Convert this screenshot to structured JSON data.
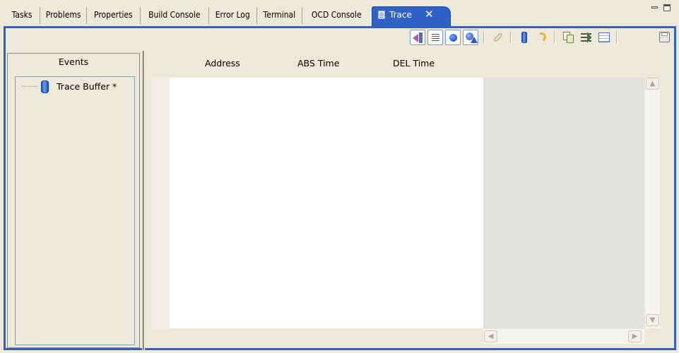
{
  "tabs": [
    "Tasks",
    "Problems",
    "Properties",
    "Build Console",
    "Error Log",
    "Terminal",
    "OCD Console"
  ],
  "active_tab": {
    "label": "Trace",
    "close": "✕"
  },
  "window_controls": {
    "minimize_icon": "minimize-icon",
    "maximize_icon": "maximize-icon"
  },
  "toolbar": {
    "icons": [
      "import-trace-icon",
      "list-view-icon",
      "record-icon",
      "trigger-setup-icon",
      "link-icon",
      "buffer-icon",
      "refresh-icon",
      "copy-icon",
      "filter-icon",
      "table-view-icon",
      "save-icon"
    ]
  },
  "events": {
    "header": "Events",
    "items": [
      {
        "label": "Trace Buffer *",
        "icon": "database-icon"
      }
    ]
  },
  "trace_table": {
    "columns": [
      "Address",
      "ABS Time",
      "DEL Time"
    ],
    "rows": []
  },
  "colors": {
    "accent": "#2e62c7",
    "chrome": "#ece9d8"
  }
}
